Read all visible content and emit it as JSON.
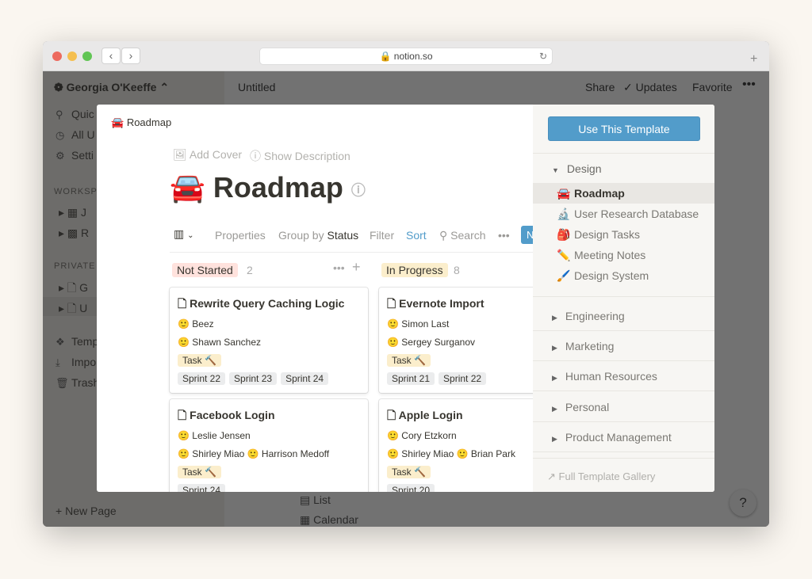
{
  "browser": {
    "url": "notion.so",
    "colors": {
      "close": "#ed6a5e",
      "min": "#f5bf4f",
      "max": "#61c554"
    }
  },
  "sidebar": {
    "workspace": "Georgia O'Keeffe",
    "items": [
      "Quic",
      "All U",
      "Setti"
    ],
    "workspace_section": "WORKSPA",
    "workspace_pages": [
      "J",
      "R"
    ],
    "private_section": "PRIVATE",
    "private_pages": [
      "G",
      "U"
    ],
    "bottom": [
      "Temp",
      "Impo",
      "Trash"
    ],
    "new_page": "New Page"
  },
  "topbar": {
    "title": "Untitled",
    "share": "Share",
    "updates": "Updates",
    "favorite": "Favorite"
  },
  "behind": {
    "list": "List",
    "calendar": "Calendar"
  },
  "modal": {
    "breadcrumb": "Roadmap",
    "add_cover": "Add Cover",
    "show_description": "Show Description",
    "title": "Roadmap",
    "emoji": "🚘",
    "toolbar": {
      "properties": "Properties",
      "group_by": "Group by",
      "group_value": "Status",
      "filter": "Filter",
      "sort": "Sort",
      "search": "Search",
      "new": "N"
    },
    "columns": [
      {
        "name": "Not Started",
        "count": "2",
        "color": "#ffe2dd",
        "cards": [
          {
            "title": "Rewrite Query Caching Logic",
            "people": [
              "Beez",
              "Shawn Sanchez"
            ],
            "type": "Task 🔨",
            "sprints": [
              "Sprint 22",
              "Sprint 23",
              "Sprint 24"
            ]
          },
          {
            "title": "Facebook Login",
            "people": [
              "Leslie Jensen",
              "Shirley Miao",
              "Harrison Medoff"
            ],
            "type": "Task 🔨",
            "sprints": [
              "Sprint 24"
            ]
          }
        ]
      },
      {
        "name": "In Progress",
        "count": "8",
        "color": "#fbeecc",
        "cards": [
          {
            "title": "Evernote Import",
            "people": [
              "Simon Last",
              "Sergey Surganov"
            ],
            "type": "Task 🔨",
            "sprints": [
              "Sprint 21",
              "Sprint 22"
            ]
          },
          {
            "title": "Apple Login",
            "people": [
              "Cory Etzkorn",
              "Shirley Miao",
              "Brian Park"
            ],
            "type": "Task 🔨",
            "sprints": [
              "Sprint 20"
            ]
          }
        ]
      }
    ],
    "panel": {
      "use_template": "Use This Template",
      "design": "Design",
      "templates": [
        {
          "emoji": "🚘",
          "label": "Roadmap"
        },
        {
          "emoji": "🔬",
          "label": "User Research Database"
        },
        {
          "emoji": "🎒",
          "label": "Design Tasks"
        },
        {
          "emoji": "✏️",
          "label": "Meeting Notes"
        },
        {
          "emoji": "🖌️",
          "label": "Design System"
        }
      ],
      "categories": [
        "Engineering",
        "Marketing",
        "Human Resources",
        "Personal",
        "Product Management"
      ],
      "gallery": "Full Template Gallery"
    },
    "accent": "#529cca"
  },
  "help": "?"
}
